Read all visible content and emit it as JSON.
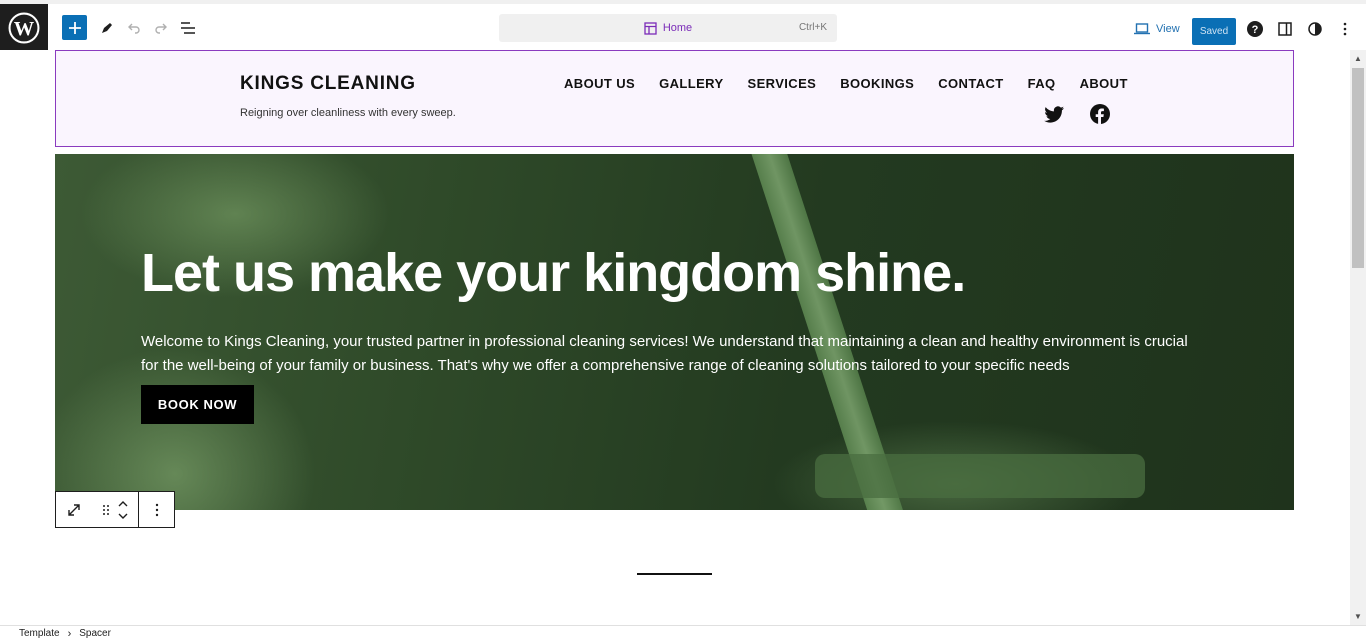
{
  "toolbar": {
    "document_title": "Home",
    "shortcut": "Ctrl+K",
    "view_label": "View",
    "saved_label": "Saved"
  },
  "site": {
    "title": "KINGS CLEANING",
    "tagline": "Reigning over cleanliness with every sweep.",
    "nav": [
      "ABOUT US",
      "GALLERY",
      "SERVICES",
      "BOOKINGS",
      "CONTACT",
      "FAQ",
      "ABOUT"
    ],
    "social_icons": [
      "twitter-icon",
      "facebook-icon"
    ]
  },
  "hero": {
    "title": "Let us make your kingdom shine.",
    "text": "Welcome to Kings Cleaning, your trusted partner in professional cleaning services! We understand that maintaining a clean and healthy environment is crucial for the well-being of your family or business. That's why we offer a comprehensive range of cleaning solutions tailored to your specific needs",
    "button": "BOOK NOW"
  },
  "breadcrumb": {
    "items": [
      "Template",
      "Spacer"
    ]
  },
  "colors": {
    "accent": "#0a6fb5",
    "selection": "#8a3bbf",
    "header_bg": "#faf5fe"
  }
}
